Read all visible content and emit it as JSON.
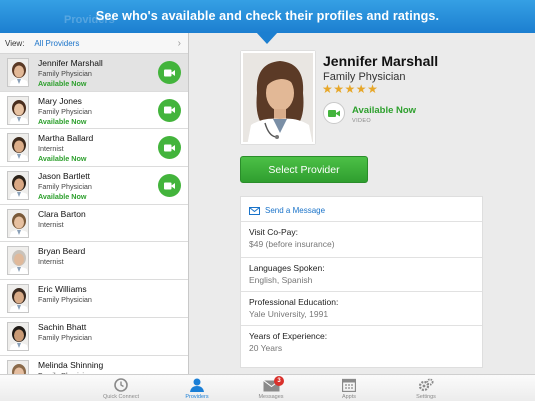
{
  "banner": {
    "text": "See who's available and check their profiles and ratings.",
    "ghost_title": "Providers"
  },
  "view_bar": {
    "label": "View:",
    "value": "All Providers"
  },
  "providers": [
    {
      "name": "Jennifer Marshall",
      "specialty": "Family Physician",
      "status": "Available Now",
      "video": true,
      "selected": true
    },
    {
      "name": "Mary Jones",
      "specialty": "Family Physician",
      "status": "Available Now",
      "video": true
    },
    {
      "name": "Martha Ballard",
      "specialty": "Internist",
      "status": "Available Now",
      "video": true
    },
    {
      "name": "Jason Bartlett",
      "specialty": "Family Physician",
      "status": "Available Now",
      "video": true
    },
    {
      "name": "Clara Barton",
      "specialty": "Internist",
      "status": "",
      "video": false
    },
    {
      "name": "Bryan Beard",
      "specialty": "Internist",
      "status": "",
      "video": false
    },
    {
      "name": "Eric Williams",
      "specialty": "Family Physician",
      "status": "",
      "video": false
    },
    {
      "name": "Sachin Bhatt",
      "specialty": "Family Physician",
      "status": "",
      "video": false
    },
    {
      "name": "Melinda Shinning",
      "specialty": "Family Physician",
      "status": "",
      "video": false
    }
  ],
  "detail": {
    "name": "Jennifer Marshall",
    "specialty": "Family Physician",
    "rating": 5,
    "rating_max": 5,
    "availability": "Available Now",
    "video_label": "VIDEO",
    "select_button": "Select Provider",
    "send_message": "Send a Message",
    "info": [
      {
        "label": "Visit Co-Pay:",
        "value": "$49 (before insurance)"
      },
      {
        "label": "Languages Spoken:",
        "value": "English, Spanish"
      },
      {
        "label": "Professional Education:",
        "value": "Yale University, 1991"
      },
      {
        "label": "Years of Experience:",
        "value": "20 Years"
      }
    ]
  },
  "tabs": [
    {
      "label": "Quick Connect",
      "icon": "clock-icon",
      "active": false
    },
    {
      "label": "Providers",
      "icon": "person-icon",
      "active": true
    },
    {
      "label": "Messages",
      "icon": "envelope-icon",
      "active": false,
      "badge": "3"
    },
    {
      "label": "Appts",
      "icon": "calendar-icon",
      "active": false
    },
    {
      "label": "Settings",
      "icon": "gears-icon",
      "active": false
    }
  ],
  "colors": {
    "accent": "#1b7fd6",
    "available": "#2ea02e",
    "video_button": "#43b43c",
    "star": "#e7a729",
    "badge": "#d9302b"
  }
}
